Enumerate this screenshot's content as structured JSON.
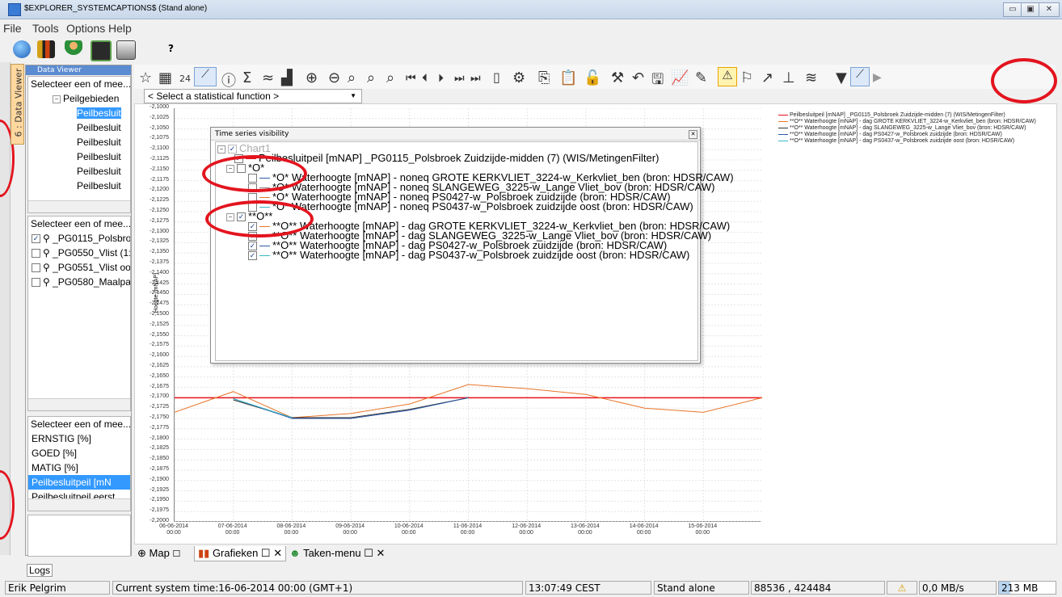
{
  "window": {
    "title": "$EXPLORER_SYSTEMCAPTIONS$ (Stand alone)"
  },
  "menu": [
    "File",
    "Tools",
    "Options",
    "Help"
  ],
  "toolbar": {
    "help": "?"
  },
  "sidebar": {
    "tab_label": "6 : Data Viewer",
    "header": "Data Viewer",
    "list1": {
      "header": "Selecteer een of mee...",
      "group": "Peilgebieden",
      "items": [
        "Peilbesluit",
        "Peilbesluit",
        "Peilbesluit",
        "Peilbesluit",
        "Peilbesluit",
        "Peilbesluit",
        "Peilbesluit"
      ]
    },
    "list2": {
      "header": "Selecteer een of mee...",
      "items": [
        "_PG0115_Polsbro",
        "_PG0550_Vlist (1:",
        "_PG0551_Vlist oo",
        "_PG0580_Maalpar"
      ]
    },
    "list3": {
      "header": "Selecteer een of mee...",
      "items": [
        "ERNSTIG [%]",
        "GOED [%]",
        "MATIG [%]",
        "Peilbesluitpeil [mN",
        "Peilbesluitpeil eerst"
      ]
    }
  },
  "chart_toolbar": {
    "num": "24",
    "stat_select": "< Select a statistical function >"
  },
  "popup": {
    "title": "Time series visibility",
    "root": "Chart1",
    "rows": [
      {
        "text": "Peilbesluitpeil [mNAP] _PG0115_Polsbroek Zuidzijde-midden (7) (WIS/MetingenFilter)"
      },
      {
        "text": "*O*"
      },
      {
        "text": "*O* Waterhoogte [mNAP] - noneq GROTE KERKVLIET_3224-w_Kerkvliet_ben (bron: HDSR/CAW)"
      },
      {
        "text": "*O* Waterhoogte [mNAP] - noneq SLANGEWEG_3225-w_Lange Vliet_bov (bron: HDSR/CAW)"
      },
      {
        "text": "*O* Waterhoogte [mNAP] - noneq PS0427-w_Polsbroek zuidzijde (bron: HDSR/CAW)"
      },
      {
        "text": "*O* Waterhoogte [mNAP] - noneq PS0437-w_Polsbroek zuidzijde oost (bron: HDSR/CAW)"
      },
      {
        "text": "**O**"
      },
      {
        "text": "**O** Waterhoogte [mNAP] - dag GROTE KERKVLIET_3224-w_Kerkvliet_ben (bron: HDSR/CAW)"
      },
      {
        "text": "**O** Waterhoogte [mNAP] - dag SLANGEWEG_3225-w_Lange Vliet_bov (bron: HDSR/CAW)"
      },
      {
        "text": "**O** Waterhoogte [mNAP] - dag PS0427-w_Polsbroek zuidzijde (bron: HDSR/CAW)"
      },
      {
        "text": "**O** Waterhoogte [mNAP] - dag PS0437-w_Polsbroek zuidzijde oost (bron: HDSR/CAW)"
      }
    ]
  },
  "chart_data": {
    "type": "line",
    "ylabel": "Hoogte (mNAP)",
    "ylim": [
      -2.2,
      -2.1
    ],
    "yticks": [
      "-2,1000",
      "-2,1025",
      "-2,1050",
      "-2,1075",
      "-2,1100",
      "-2,1125",
      "-2,1150",
      "-2,1175",
      "-2,1200",
      "-2,1225",
      "-2,1250",
      "-2,1275",
      "-2,1300",
      "-2,1325",
      "-2,1350",
      "-2,1375",
      "-2,1400",
      "-2,1425",
      "-2,1450",
      "-2,1475",
      "-2,1500",
      "-2,1525",
      "-2,1550",
      "-2,1575",
      "-2,1600",
      "-2,1625",
      "-2,1650",
      "-2,1675",
      "-2,1700",
      "-2,1725",
      "-2,1750",
      "-2,1775",
      "-2,1800",
      "-2,1825",
      "-2,1850",
      "-2,1875",
      "-2,1900",
      "-2,1925",
      "-2,1950",
      "-2,1975",
      "-2,2000"
    ],
    "xticks": [
      [
        "06-06-2014",
        "00:00"
      ],
      [
        "07-06-2014",
        "00:00"
      ],
      [
        "08-06-2014",
        "00:00"
      ],
      [
        "09-06-2014",
        "00:00"
      ],
      [
        "10-06-2014",
        "00:00"
      ],
      [
        "11-06-2014",
        "00:00"
      ],
      [
        "12-06-2014",
        "00:00"
      ],
      [
        "13-06-2014",
        "00:00"
      ],
      [
        "14-06-2014",
        "00:00"
      ],
      [
        "15-06-2014",
        "00:00"
      ]
    ],
    "xrange_days": [
      0,
      10
    ],
    "series": [
      {
        "name": "Peilbesluitpeil [mNAP] _PG0115_Polsbroek Zuidzijde-midden (7) (WIS/MetingenFilter)",
        "color": "#e8121c",
        "x": [
          0,
          10
        ],
        "y": [
          -2.17,
          -2.17
        ]
      },
      {
        "name": "**O** Waterhoogte [mNAP] - dag GROTE KERKVLIET_3224-w_Kerkvliet_ben (bron: HDSR/CAW)",
        "color": "#e8752a",
        "x": [
          0,
          1,
          2,
          3,
          4,
          5,
          6,
          7,
          8,
          9,
          10
        ],
        "y": [
          -2.1735,
          -2.1685,
          -2.1748,
          -2.1738,
          -2.1715,
          -2.1668,
          -2.1678,
          -2.1692,
          -2.1725,
          -2.1735,
          -2.17
        ]
      },
      {
        "name": "**O** Waterhoogte [mNAP] - dag SLANGEWEG_3225-w_Lange Vliet_bov (bron: HDSR/CAW)",
        "color": "#333333",
        "x": [
          1,
          2,
          3,
          4,
          5
        ],
        "y": [
          -2.1705,
          -2.1748,
          -2.1748,
          -2.1728,
          -2.17
        ]
      },
      {
        "name": "**O** Waterhoogte [mNAP] - dag PS0427-w_Polsbroek zuidzijde (bron: HDSR/CAW)",
        "color": "#2d5aa8",
        "x": [
          1,
          2,
          3,
          4,
          5
        ],
        "y": [
          -2.1702,
          -2.175,
          -2.175,
          -2.173,
          -2.17
        ]
      },
      {
        "name": "**O** Waterhoogte [mNAP] - dag PS0437-w_Polsbroek zuidzijde oost (bron: HDSR/CAW)",
        "color": "#37b8c8",
        "x": [
          1,
          2
        ],
        "y": [
          -2.1702,
          -2.1748
        ]
      }
    ]
  },
  "bottom_tabs": [
    "Map",
    "Grafieken",
    "Taken-menu"
  ],
  "logs": "Logs",
  "status": {
    "user": "Erik Pelgrim",
    "time": "Current system time:16-06-2014 00:00 (GMT+1)",
    "clock": "13:07:49 CEST",
    "mode": "Stand alone",
    "coords": "88536 , 424484",
    "rate": "0,0 MB/s",
    "mem": "213 MB"
  }
}
